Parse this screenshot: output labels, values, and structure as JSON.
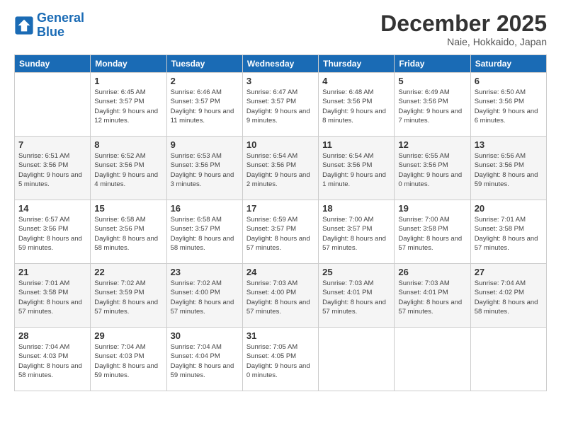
{
  "header": {
    "logo_general": "General",
    "logo_blue": "Blue",
    "month": "December 2025",
    "location": "Naie, Hokkaido, Japan"
  },
  "days_of_week": [
    "Sunday",
    "Monday",
    "Tuesday",
    "Wednesday",
    "Thursday",
    "Friday",
    "Saturday"
  ],
  "weeks": [
    [
      {
        "day": "",
        "sunrise": "",
        "sunset": "",
        "daylight": ""
      },
      {
        "day": "1",
        "sunrise": "Sunrise: 6:45 AM",
        "sunset": "Sunset: 3:57 PM",
        "daylight": "Daylight: 9 hours and 12 minutes."
      },
      {
        "day": "2",
        "sunrise": "Sunrise: 6:46 AM",
        "sunset": "Sunset: 3:57 PM",
        "daylight": "Daylight: 9 hours and 11 minutes."
      },
      {
        "day": "3",
        "sunrise": "Sunrise: 6:47 AM",
        "sunset": "Sunset: 3:57 PM",
        "daylight": "Daylight: 9 hours and 9 minutes."
      },
      {
        "day": "4",
        "sunrise": "Sunrise: 6:48 AM",
        "sunset": "Sunset: 3:56 PM",
        "daylight": "Daylight: 9 hours and 8 minutes."
      },
      {
        "day": "5",
        "sunrise": "Sunrise: 6:49 AM",
        "sunset": "Sunset: 3:56 PM",
        "daylight": "Daylight: 9 hours and 7 minutes."
      },
      {
        "day": "6",
        "sunrise": "Sunrise: 6:50 AM",
        "sunset": "Sunset: 3:56 PM",
        "daylight": "Daylight: 9 hours and 6 minutes."
      }
    ],
    [
      {
        "day": "7",
        "sunrise": "Sunrise: 6:51 AM",
        "sunset": "Sunset: 3:56 PM",
        "daylight": "Daylight: 9 hours and 5 minutes."
      },
      {
        "day": "8",
        "sunrise": "Sunrise: 6:52 AM",
        "sunset": "Sunset: 3:56 PM",
        "daylight": "Daylight: 9 hours and 4 minutes."
      },
      {
        "day": "9",
        "sunrise": "Sunrise: 6:53 AM",
        "sunset": "Sunset: 3:56 PM",
        "daylight": "Daylight: 9 hours and 3 minutes."
      },
      {
        "day": "10",
        "sunrise": "Sunrise: 6:54 AM",
        "sunset": "Sunset: 3:56 PM",
        "daylight": "Daylight: 9 hours and 2 minutes."
      },
      {
        "day": "11",
        "sunrise": "Sunrise: 6:54 AM",
        "sunset": "Sunset: 3:56 PM",
        "daylight": "Daylight: 9 hours and 1 minute."
      },
      {
        "day": "12",
        "sunrise": "Sunrise: 6:55 AM",
        "sunset": "Sunset: 3:56 PM",
        "daylight": "Daylight: 9 hours and 0 minutes."
      },
      {
        "day": "13",
        "sunrise": "Sunrise: 6:56 AM",
        "sunset": "Sunset: 3:56 PM",
        "daylight": "Daylight: 8 hours and 59 minutes."
      }
    ],
    [
      {
        "day": "14",
        "sunrise": "Sunrise: 6:57 AM",
        "sunset": "Sunset: 3:56 PM",
        "daylight": "Daylight: 8 hours and 59 minutes."
      },
      {
        "day": "15",
        "sunrise": "Sunrise: 6:58 AM",
        "sunset": "Sunset: 3:56 PM",
        "daylight": "Daylight: 8 hours and 58 minutes."
      },
      {
        "day": "16",
        "sunrise": "Sunrise: 6:58 AM",
        "sunset": "Sunset: 3:57 PM",
        "daylight": "Daylight: 8 hours and 58 minutes."
      },
      {
        "day": "17",
        "sunrise": "Sunrise: 6:59 AM",
        "sunset": "Sunset: 3:57 PM",
        "daylight": "Daylight: 8 hours and 57 minutes."
      },
      {
        "day": "18",
        "sunrise": "Sunrise: 7:00 AM",
        "sunset": "Sunset: 3:57 PM",
        "daylight": "Daylight: 8 hours and 57 minutes."
      },
      {
        "day": "19",
        "sunrise": "Sunrise: 7:00 AM",
        "sunset": "Sunset: 3:58 PM",
        "daylight": "Daylight: 8 hours and 57 minutes."
      },
      {
        "day": "20",
        "sunrise": "Sunrise: 7:01 AM",
        "sunset": "Sunset: 3:58 PM",
        "daylight": "Daylight: 8 hours and 57 minutes."
      }
    ],
    [
      {
        "day": "21",
        "sunrise": "Sunrise: 7:01 AM",
        "sunset": "Sunset: 3:58 PM",
        "daylight": "Daylight: 8 hours and 57 minutes."
      },
      {
        "day": "22",
        "sunrise": "Sunrise: 7:02 AM",
        "sunset": "Sunset: 3:59 PM",
        "daylight": "Daylight: 8 hours and 57 minutes."
      },
      {
        "day": "23",
        "sunrise": "Sunrise: 7:02 AM",
        "sunset": "Sunset: 4:00 PM",
        "daylight": "Daylight: 8 hours and 57 minutes."
      },
      {
        "day": "24",
        "sunrise": "Sunrise: 7:03 AM",
        "sunset": "Sunset: 4:00 PM",
        "daylight": "Daylight: 8 hours and 57 minutes."
      },
      {
        "day": "25",
        "sunrise": "Sunrise: 7:03 AM",
        "sunset": "Sunset: 4:01 PM",
        "daylight": "Daylight: 8 hours and 57 minutes."
      },
      {
        "day": "26",
        "sunrise": "Sunrise: 7:03 AM",
        "sunset": "Sunset: 4:01 PM",
        "daylight": "Daylight: 8 hours and 57 minutes."
      },
      {
        "day": "27",
        "sunrise": "Sunrise: 7:04 AM",
        "sunset": "Sunset: 4:02 PM",
        "daylight": "Daylight: 8 hours and 58 minutes."
      }
    ],
    [
      {
        "day": "28",
        "sunrise": "Sunrise: 7:04 AM",
        "sunset": "Sunset: 4:03 PM",
        "daylight": "Daylight: 8 hours and 58 minutes."
      },
      {
        "day": "29",
        "sunrise": "Sunrise: 7:04 AM",
        "sunset": "Sunset: 4:03 PM",
        "daylight": "Daylight: 8 hours and 59 minutes."
      },
      {
        "day": "30",
        "sunrise": "Sunrise: 7:04 AM",
        "sunset": "Sunset: 4:04 PM",
        "daylight": "Daylight: 8 hours and 59 minutes."
      },
      {
        "day": "31",
        "sunrise": "Sunrise: 7:05 AM",
        "sunset": "Sunset: 4:05 PM",
        "daylight": "Daylight: 9 hours and 0 minutes."
      },
      {
        "day": "",
        "sunrise": "",
        "sunset": "",
        "daylight": ""
      },
      {
        "day": "",
        "sunrise": "",
        "sunset": "",
        "daylight": ""
      },
      {
        "day": "",
        "sunrise": "",
        "sunset": "",
        "daylight": ""
      }
    ]
  ]
}
